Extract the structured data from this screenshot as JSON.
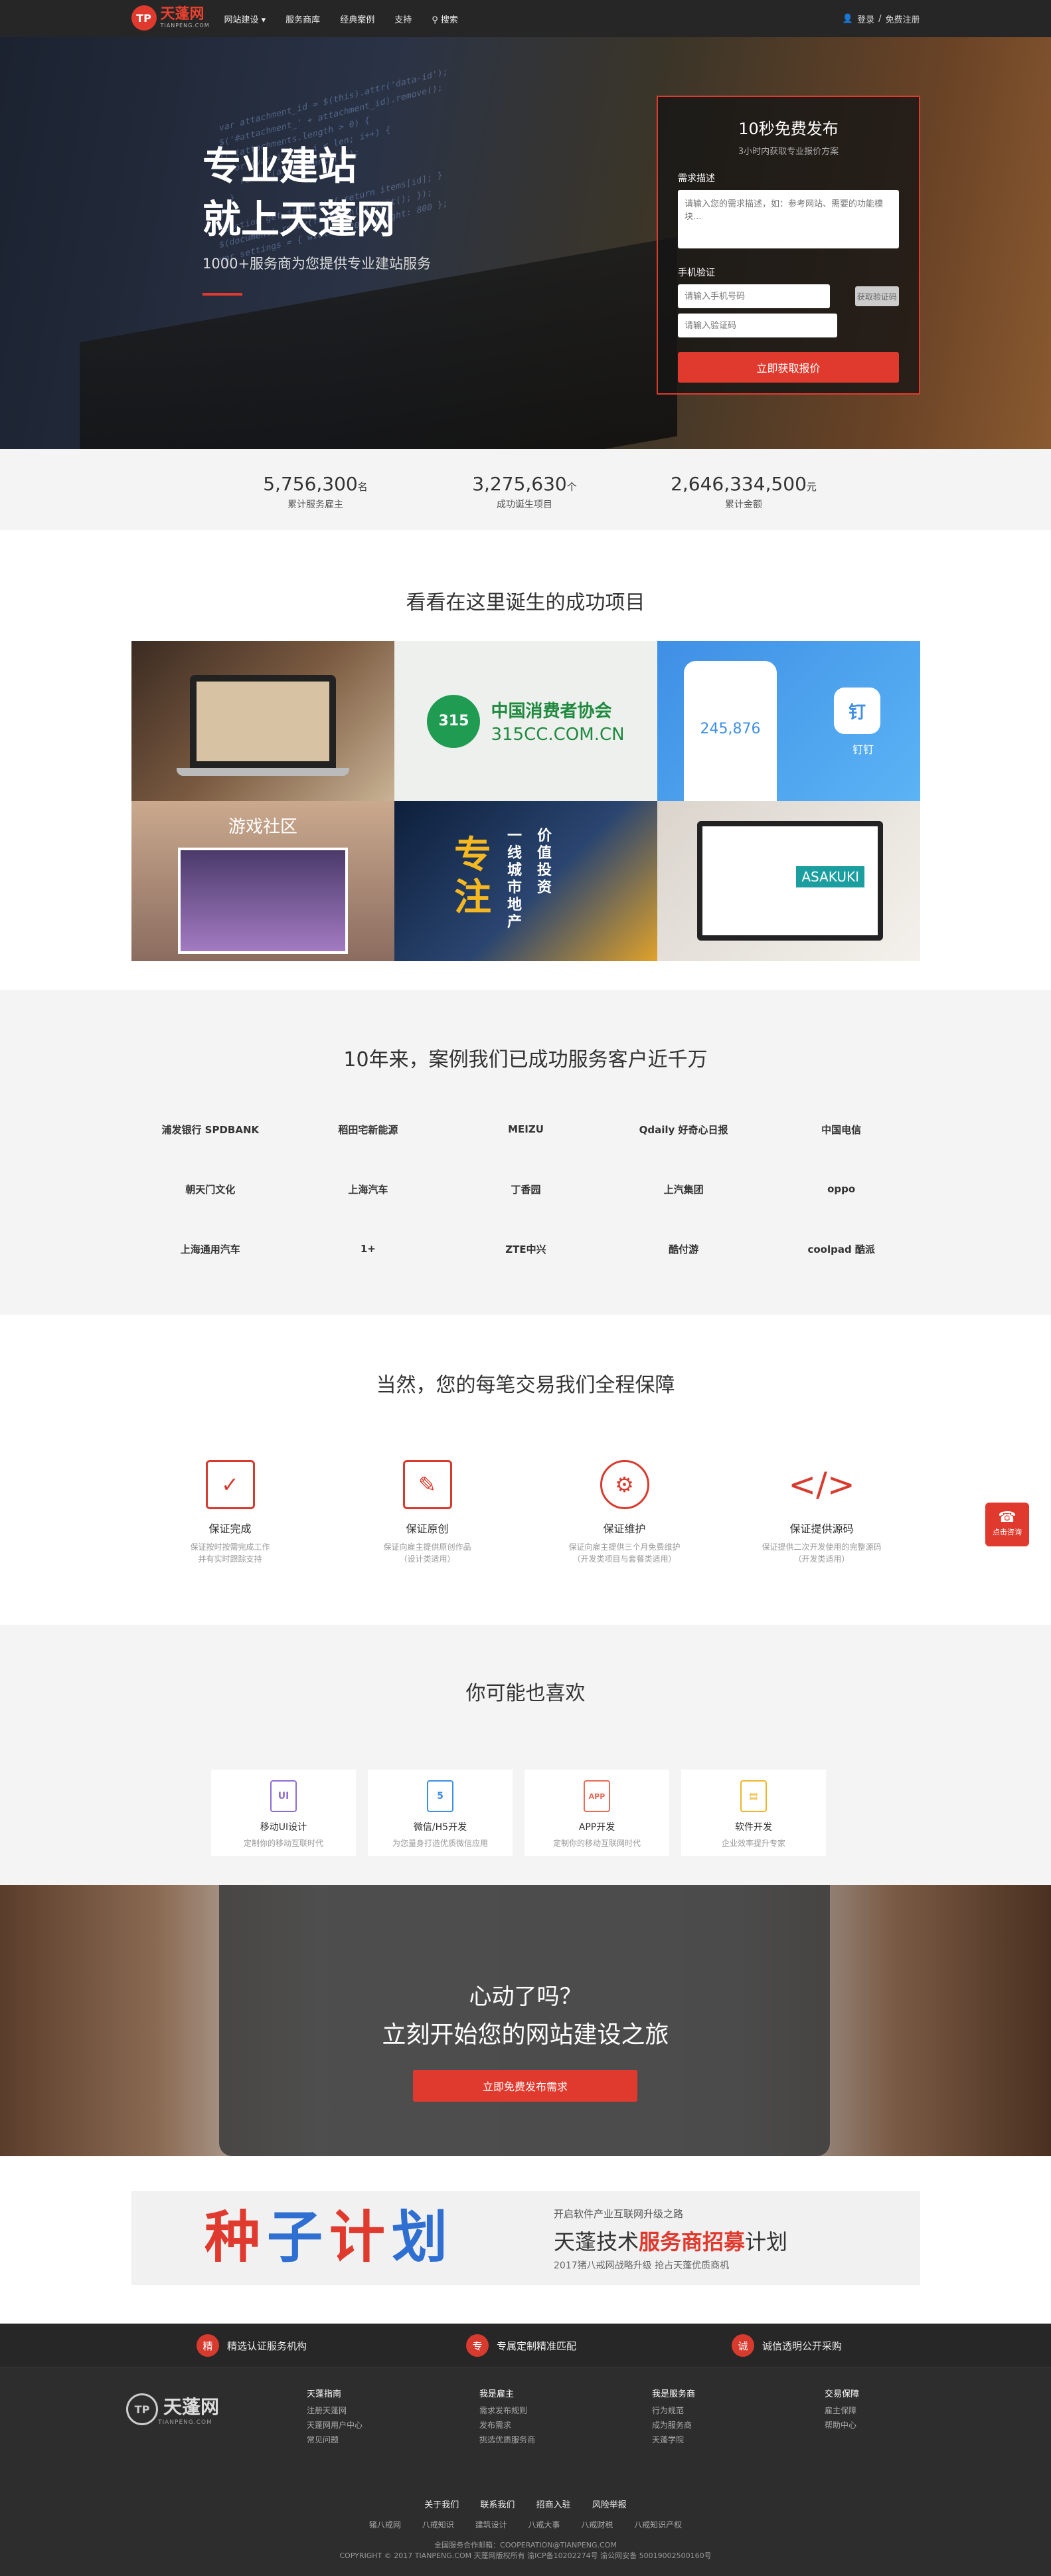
{
  "nav": {
    "logo_cn": "天蓬网",
    "logo_en": "TIANPENG.COM",
    "items": [
      "网站建设 ▾",
      "服务商库",
      "经典案例",
      "支持",
      "搜索"
    ],
    "login": "登录",
    "sep": "/",
    "register": "免费注册"
  },
  "hero": {
    "title1": "专业建站",
    "title2": "就上天蓬网",
    "subtitle": "1000+服务商为您提供专业建站服务"
  },
  "form": {
    "title": "10秒免费发布",
    "subtitle": "3小时内获取专业报价方案",
    "need_label": "需求描述",
    "need_placeholder": "请输入您的需求描述，如：参考网站、需要的功能模块...",
    "phone_label": "手机验证",
    "phone_placeholder": "请输入手机号码",
    "code_button": "获取验证码",
    "code_placeholder": "请输入验证码",
    "submit": "立即获取报价"
  },
  "stats": [
    {
      "num": "5,756,300",
      "unit": "名",
      "label": "累计服务雇主"
    },
    {
      "num": "3,275,630",
      "unit": "个",
      "label": "成功诞生项目"
    },
    {
      "num": "2,646,334,500",
      "unit": "元",
      "label": "累计金额"
    }
  ],
  "cases": {
    "title": "看看在这里诞生的成功项目",
    "cca_cn": "中国消费者协会",
    "cca_en": "315CC.COM.CN",
    "cca_badge": "315",
    "app_num": "245,876",
    "ding": "钉",
    "ding_label": "钉钉",
    "game": "游戏社区",
    "zhu": "专注",
    "zhu_a": "一线城市地产",
    "zhu_b": "价值投资",
    "asakuki": "ASAKUKI"
  },
  "clients": {
    "title": "10年来，案例我们已成功服务客户近千万",
    "items": [
      "浦发银行 SPDBANK",
      "稻田宅新能源",
      "MEIZU",
      "Qdaily 好奇心日报",
      "中国电信",
      "朝天门文化",
      "上海汽车",
      "丁香园",
      "上汽集团",
      "oppo",
      "上海通用汽车",
      "1+",
      "ZTE中兴",
      "酷付游",
      "coolpad 酷派"
    ]
  },
  "guarantee": {
    "title": "当然，您的每笔交易我们全程保障",
    "items": [
      {
        "icon": "✓",
        "title": "保证完成",
        "desc1": "保证按时按需完成工作",
        "desc2": "并有实时跟踪支持"
      },
      {
        "icon": "✎",
        "title": "保证原创",
        "desc1": "保证向雇主提供原创作品",
        "desc2": "（设计类适用）"
      },
      {
        "icon": "⚙",
        "title": "保证维护",
        "desc1": "保证向雇主提供三个月免费维护",
        "desc2": "（开发类项目与套餐类适用）"
      },
      {
        "icon": "</>",
        "title": "保证提供源码",
        "desc1": "保证提供二次开发使用的完整源码",
        "desc2": "（开发类适用）"
      }
    ]
  },
  "float_button": {
    "icon": "☎",
    "label": "点击咨询"
  },
  "likes": {
    "title": "你可能也喜欢",
    "items": [
      {
        "icon": "UI",
        "title": "移动UI设计",
        "desc": "定制你的移动互联时代",
        "color": "#8e6bd6"
      },
      {
        "icon": "5",
        "title": "微信/H5开发",
        "desc": "为您量身打造优质微信应用",
        "color": "#3f8fe5"
      },
      {
        "icon": "APP",
        "title": "APP开发",
        "desc": "定制你的移动互联网时代",
        "color": "#e86b57"
      },
      {
        "icon": "▤",
        "title": "软件开发",
        "desc": "企业效率提升专家",
        "color": "#f0b429"
      }
    ]
  },
  "cta": {
    "line1": "心动了吗？",
    "line2": "立刻开始您的网站建设之旅",
    "button": "立即免费发布需求"
  },
  "seed": {
    "big": [
      "种",
      "子",
      "计",
      "划"
    ],
    "line1": "开启软件产业互联网升级之路",
    "line2a": "天蓬技术",
    "line2b": "服务商招募",
    "line2c": "计划",
    "line3": "2017猪八戒网战略升级 抢占天蓬优质商机"
  },
  "footer": {
    "features": [
      {
        "icon": "精",
        "label": "精选认证服务机构"
      },
      {
        "icon": "专",
        "label": "专属定制精准匹配"
      },
      {
        "icon": "诚",
        "label": "诚信透明公开采购"
      }
    ],
    "logo_mark": "TP",
    "logo_cn": "天蓬网",
    "logo_en": "TIANPENG.COM",
    "cols": [
      {
        "h": "天蓬指南",
        "items": [
          "注册天蓬网",
          "天蓬网用户中心",
          "常见问题"
        ]
      },
      {
        "h": "我是雇主",
        "items": [
          "需求发布规则",
          "发布需求",
          "挑选优质服务商"
        ]
      },
      {
        "h": "我是服务商",
        "items": [
          "行为规范",
          "成为服务商",
          "天蓬学院"
        ]
      },
      {
        "h": "交易保障",
        "items": [
          "雇主保障",
          "帮助中心"
        ]
      }
    ],
    "links1": [
      "关于我们",
      "联系我们",
      "招商入驻",
      "风险举报"
    ],
    "links2": [
      "猪八戒网",
      "八戒知识",
      "建筑设计",
      "八戒大事",
      "八戒财税",
      "八戒知识产权"
    ],
    "copy1": "全国服务合作邮箱：COOPERATION@TIANPENG.COM",
    "copy2": "COPYRIGHT © 2017 TIANPENG.COM 天蓬网版权所有 渝ICP备10202274号   渝公网安备 50019002500160号"
  }
}
